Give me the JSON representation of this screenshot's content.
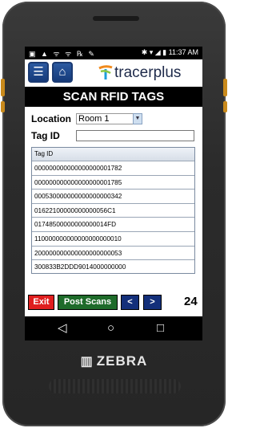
{
  "statusbar": {
    "left_icons": "▣ ▲ ᯤ ᯤ ℞ ✎",
    "right_icons": "✱ ▾ ◢ ▮",
    "time": "11:37 AM"
  },
  "app": {
    "brand": "tracerplus",
    "menu_icon": "menu-icon",
    "home_icon": "home-icon"
  },
  "screen_title": "SCAN RFID TAGS",
  "form": {
    "location_label": "Location",
    "location_value": "Room 1",
    "tagid_label": "Tag ID",
    "tagid_value": ""
  },
  "table": {
    "header": "Tag ID",
    "rows": [
      "000000000000000000001782",
      "000000000000000000001785",
      "000530000000000000000342",
      "01622100000000000056C1",
      "01748500000000000014FD",
      "110000000000000000000010",
      "200000000000000000000053",
      "300833B2DDD9014000000000"
    ]
  },
  "actions": {
    "exit": "Exit",
    "post_scans": "Post Scans",
    "prev": "<",
    "next": ">",
    "count": "24"
  },
  "colors": {
    "exit_bg": "#e01e1e",
    "post_bg": "#1e6b2a",
    "nav_bg": "#132f7a"
  },
  "device": {
    "brand": "ZEBRA"
  },
  "navbar": {
    "back": "◁",
    "home": "○",
    "recents": "□"
  }
}
